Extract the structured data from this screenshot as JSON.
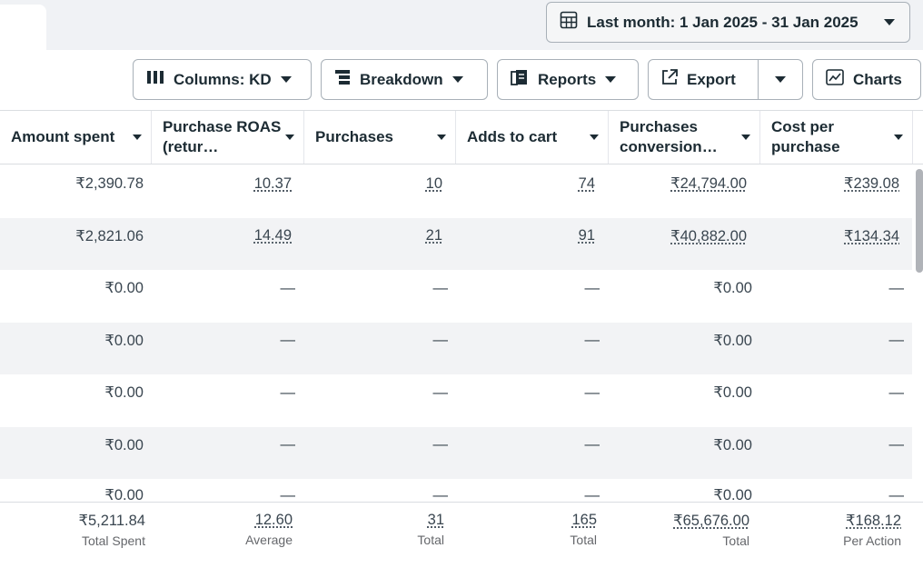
{
  "date_range": {
    "label": "Last month: 1 Jan 2025 - 31 Jan 2025"
  },
  "toolbar": {
    "columns_label": "Columns: KD",
    "breakdown_label": "Breakdown",
    "reports_label": "Reports",
    "export_label": "Export",
    "charts_label": "Charts"
  },
  "columns": [
    {
      "label": "Amount spent"
    },
    {
      "label": "Purchase ROAS (retur…"
    },
    {
      "label": "Purchases"
    },
    {
      "label": "Adds to cart"
    },
    {
      "label": "Purchases conversion…"
    },
    {
      "label": "Cost per purchase"
    }
  ],
  "rows": [
    {
      "cells": [
        "₹2,390.78",
        "10.37",
        "10",
        "74",
        "₹24,794.00",
        "₹239.08"
      ]
    },
    {
      "cells": [
        "₹2,821.06",
        "14.49",
        "21",
        "91",
        "₹40,882.00",
        "₹134.34"
      ]
    },
    {
      "cells": [
        "₹0.00",
        "—",
        "—",
        "—",
        "₹0.00",
        "—"
      ]
    },
    {
      "cells": [
        "₹0.00",
        "—",
        "—",
        "—",
        "₹0.00",
        "—"
      ]
    },
    {
      "cells": [
        "₹0.00",
        "—",
        "—",
        "—",
        "₹0.00",
        "—"
      ]
    },
    {
      "cells": [
        "₹0.00",
        "—",
        "—",
        "—",
        "₹0.00",
        "—"
      ]
    },
    {
      "cells": [
        "₹0.00",
        "—",
        "—",
        "—",
        "₹0.00",
        "—"
      ]
    }
  ],
  "totals": [
    {
      "value": "₹5,211.84",
      "label": "Total Spent"
    },
    {
      "value": "12.60",
      "label": "Average"
    },
    {
      "value": "31",
      "label": "Total"
    },
    {
      "value": "165",
      "label": "Total"
    },
    {
      "value": "₹65,676.00",
      "label": "Total"
    },
    {
      "value": "₹168.12",
      "label": "Per Action"
    }
  ]
}
